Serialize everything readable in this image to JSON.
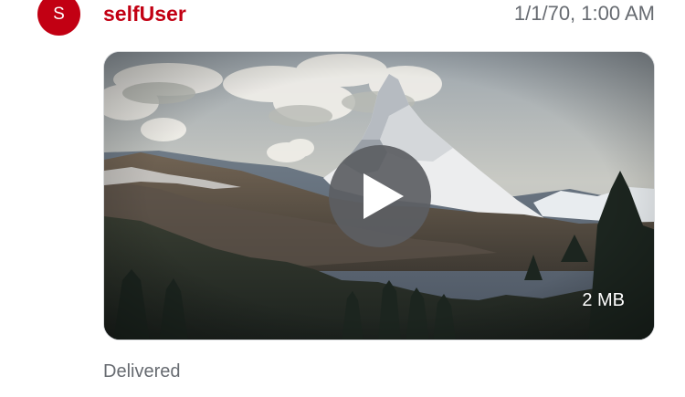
{
  "message": {
    "avatar_initial": "S",
    "username": "selfUser",
    "timestamp": "1/1/70, 1:00 AM",
    "status": "Delivered"
  },
  "video": {
    "file_size": "2 MB",
    "play_icon": "play-icon",
    "thumbnail": "mountain-landscape"
  },
  "colors": {
    "accent": "#c20013",
    "secondary_text": "#676b71",
    "play_button_bg": "#5c5e63"
  }
}
